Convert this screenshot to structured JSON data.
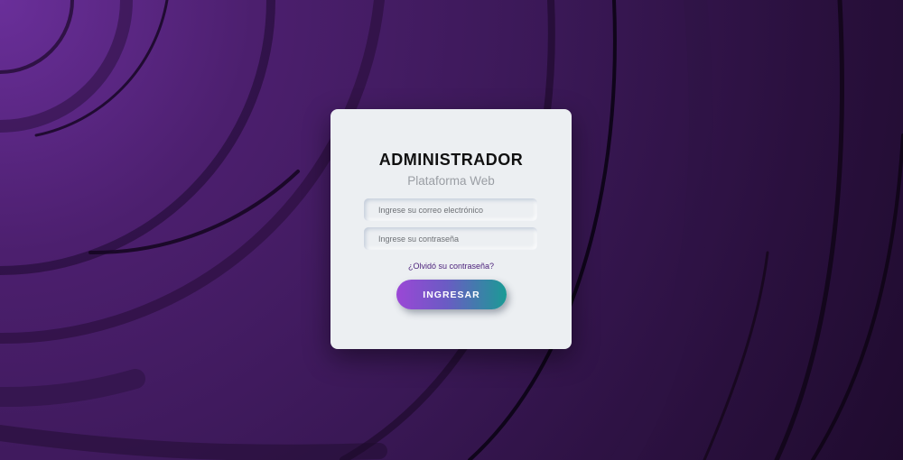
{
  "login": {
    "title": "ADMINISTRADOR",
    "subtitle": "Plataforma Web",
    "email_placeholder": "Ingrese su correo electrónico",
    "email_value": "",
    "password_placeholder": "Ingrese su contraseña",
    "password_value": "",
    "forgot_label": "¿Olvidó su contraseña?",
    "submit_label": "INGRESAR"
  },
  "colors": {
    "background": "#3a1856",
    "card": "#eceff2",
    "accent_start": "#9b47d6",
    "accent_end": "#1a9b95",
    "link": "#4a1f7a"
  }
}
